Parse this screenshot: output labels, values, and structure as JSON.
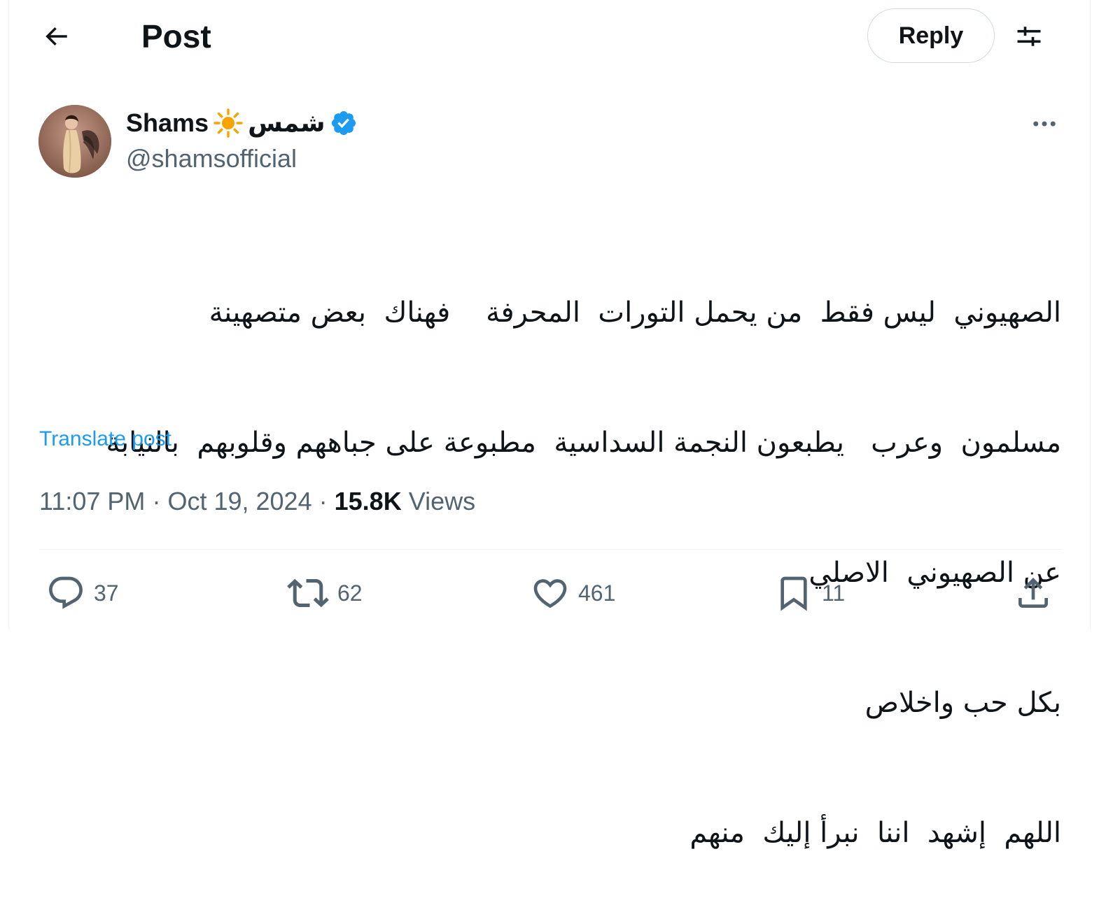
{
  "header": {
    "title": "Post",
    "reply_label": "Reply",
    "back_icon": "arrow-left-icon",
    "settings_icon": "sliders-icon"
  },
  "author": {
    "display_name_latin": "Shams",
    "display_name_arabic": "شمس",
    "handle": "@shamsofficial",
    "verified": true,
    "sun_emoji": "☀",
    "avatar_icon": "profile-photo"
  },
  "post": {
    "lines": [
      "الصهيوني  ليس فقط  من يحمل التورات  المحرفة    فهناك  بعض متصهينة",
      "مسلمون  وعرب   يطبعون النجمة السداسية  مطبوعة على جباههم وقلوبهم  بالنيابة",
      "عن الصهيوني  الاصلي",
      "بكل حب واخلاص",
      "اللهم  إشهد  اننا  نبرأ إليك  منهم"
    ],
    "translate_label": "Translate post",
    "time": "11:07 PM",
    "date": "Oct 19, 2024",
    "separator": "·",
    "views_count": "15.8K",
    "views_label": "Views"
  },
  "actions": {
    "replies": "37",
    "reposts": "62",
    "likes": "461",
    "bookmarks": "11"
  },
  "colors": {
    "accent": "#1d9bf0",
    "text_primary": "#0f1419",
    "text_secondary": "#536471",
    "border": "#cfd9de",
    "sun": "#f7a400"
  }
}
